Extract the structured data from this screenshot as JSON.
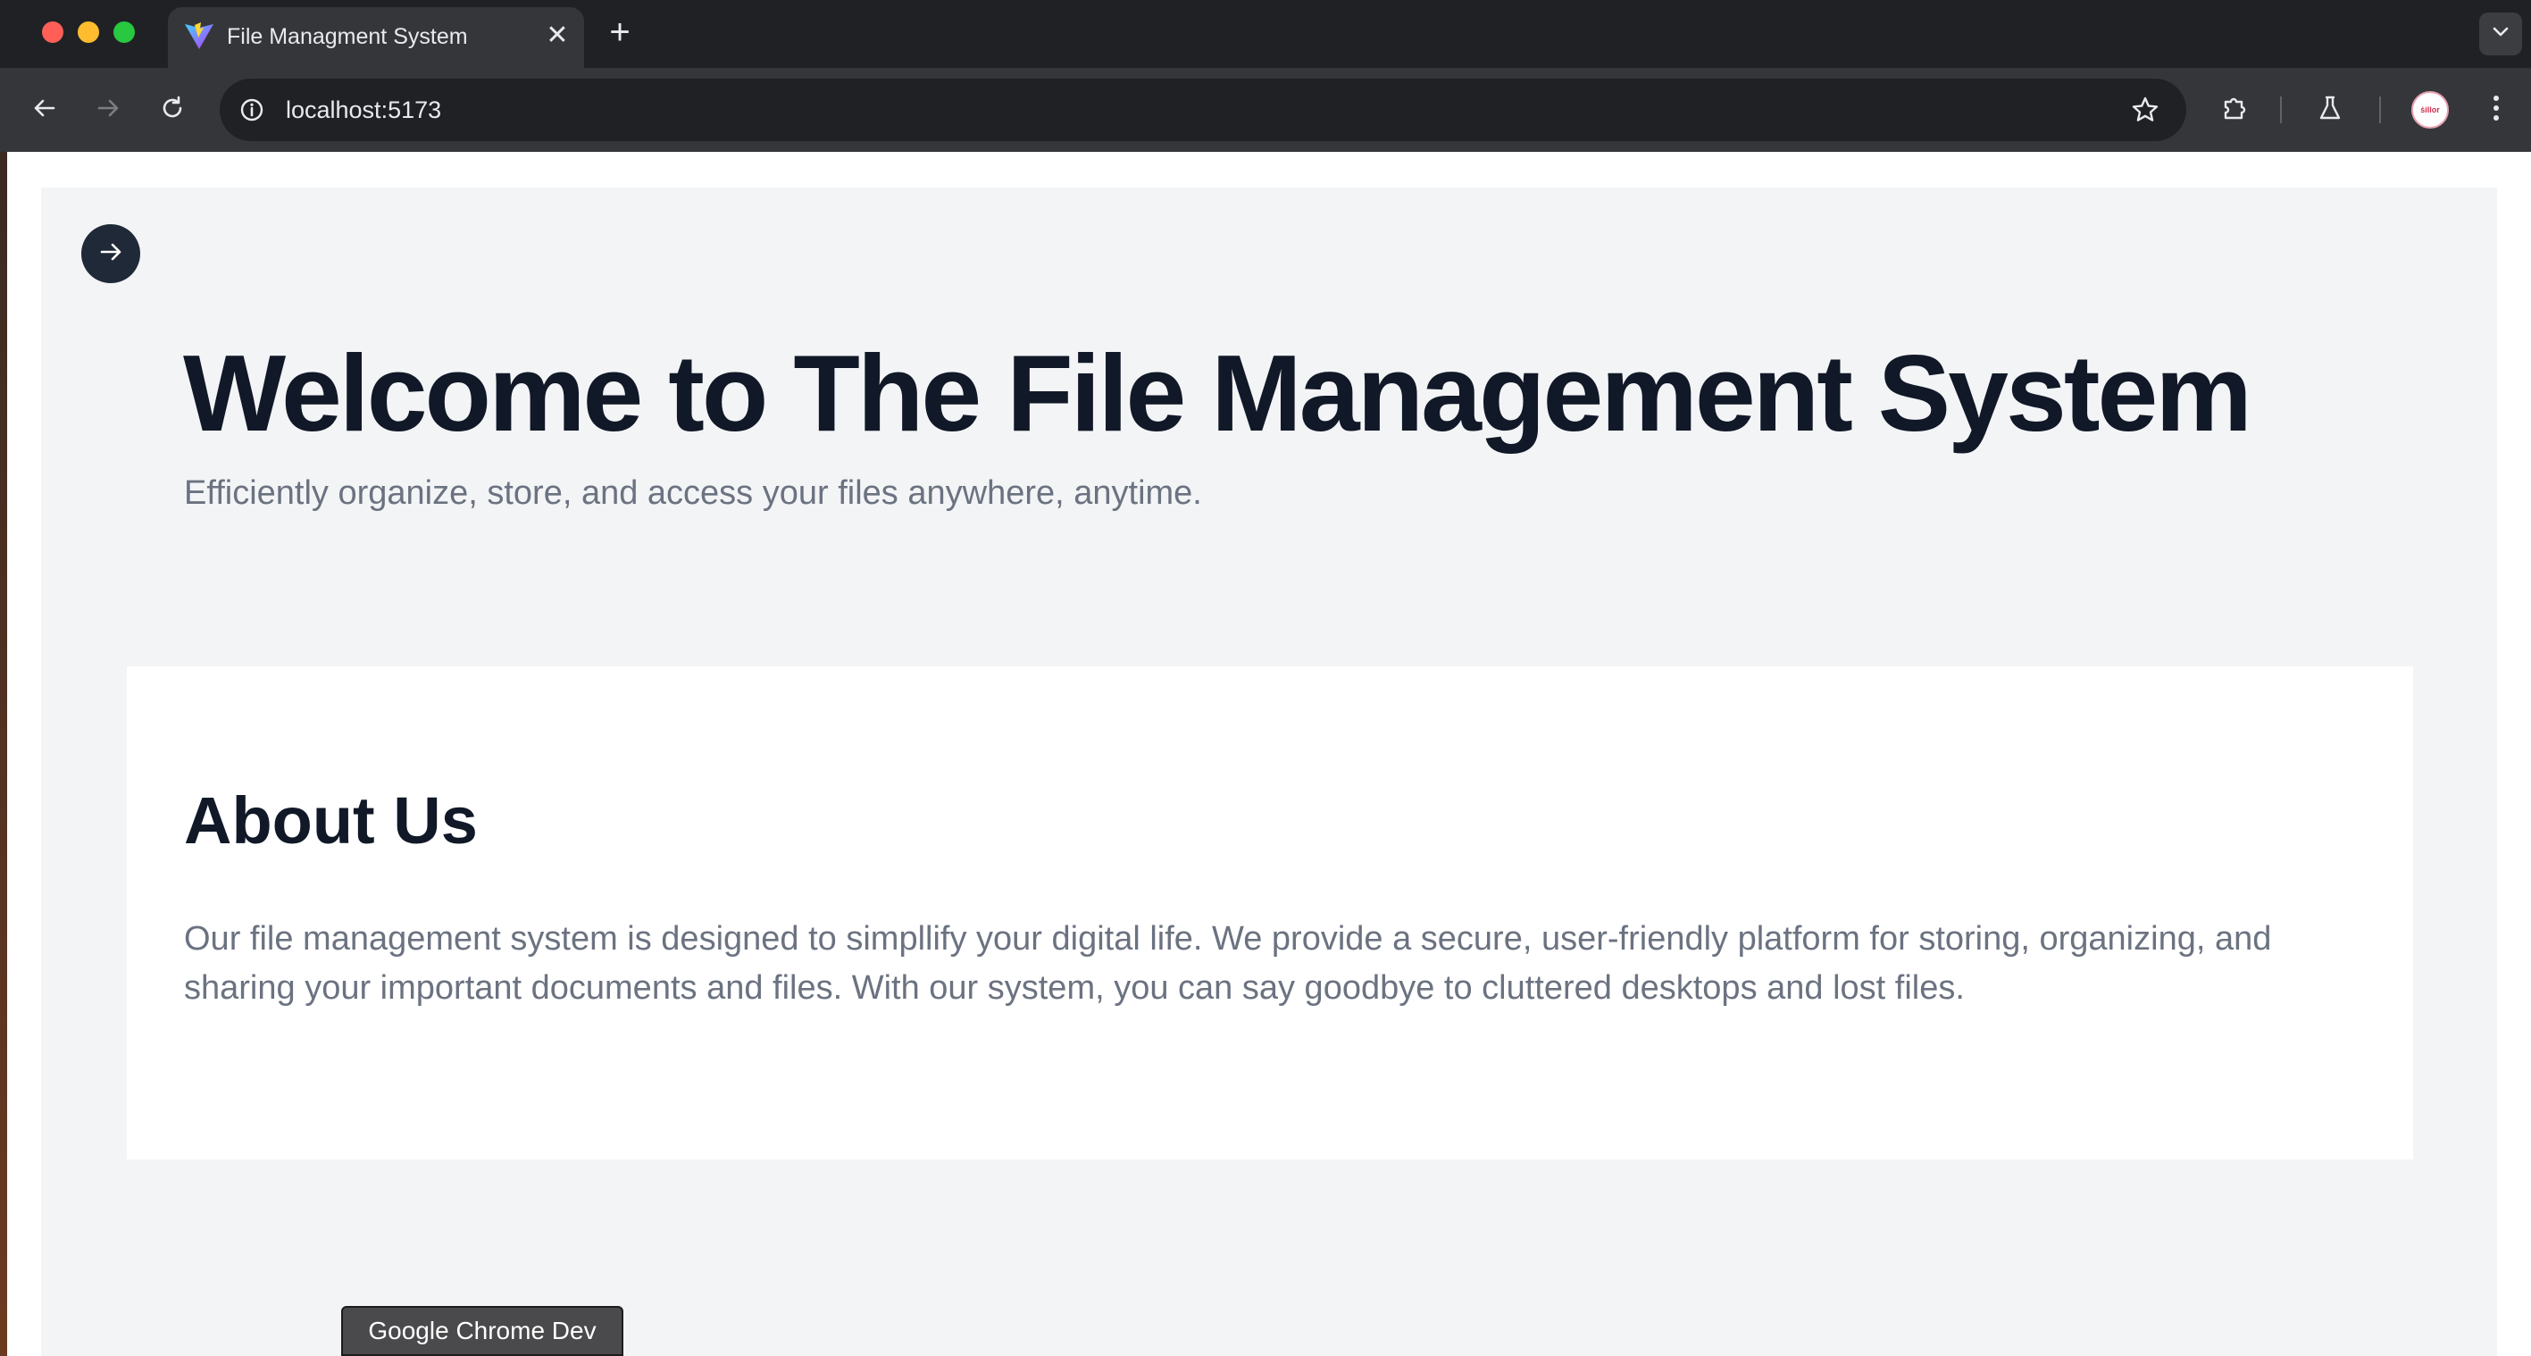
{
  "browser": {
    "tab": {
      "title": "File Managment System",
      "close_symbol": "✕"
    },
    "new_tab_symbol": "+",
    "address_bar": {
      "url": "localhost:5173"
    },
    "profile_avatar_text": "ṡillor"
  },
  "page": {
    "hero": {
      "title": "Welcome to The File Management System",
      "subtitle": "Efficiently organize, store, and access your files anywhere, anytime."
    },
    "about": {
      "title": "About Us",
      "text": "Our file management system is designed to simpllify your digital life. We provide a secure, user-friendly platform for storing, organizing, and sharing your important documents and files. With our system, you can say goodbye to cluttered desktops and lost files."
    }
  },
  "dock_tooltip": "Google Chrome Dev",
  "colors": {
    "tabstrip_bg": "#202124",
    "toolbar_bg": "#35363a",
    "page_bg": "#f3f4f6",
    "card_bg": "#ffffff",
    "heading": "#111827",
    "body_text": "#6b7280",
    "fab_bg": "#1f2937"
  },
  "icons": {
    "favicon": "vite-logo-icon",
    "back": "back-arrow-icon",
    "forward": "forward-arrow-icon",
    "reload": "reload-icon",
    "site_info": "info-icon",
    "bookmark": "star-icon",
    "extensions": "puzzle-icon",
    "labs": "flask-icon",
    "menu": "kebab-menu-icon",
    "tab_search": "chevron-down-icon",
    "sidebar_toggle": "arrow-right-icon"
  }
}
